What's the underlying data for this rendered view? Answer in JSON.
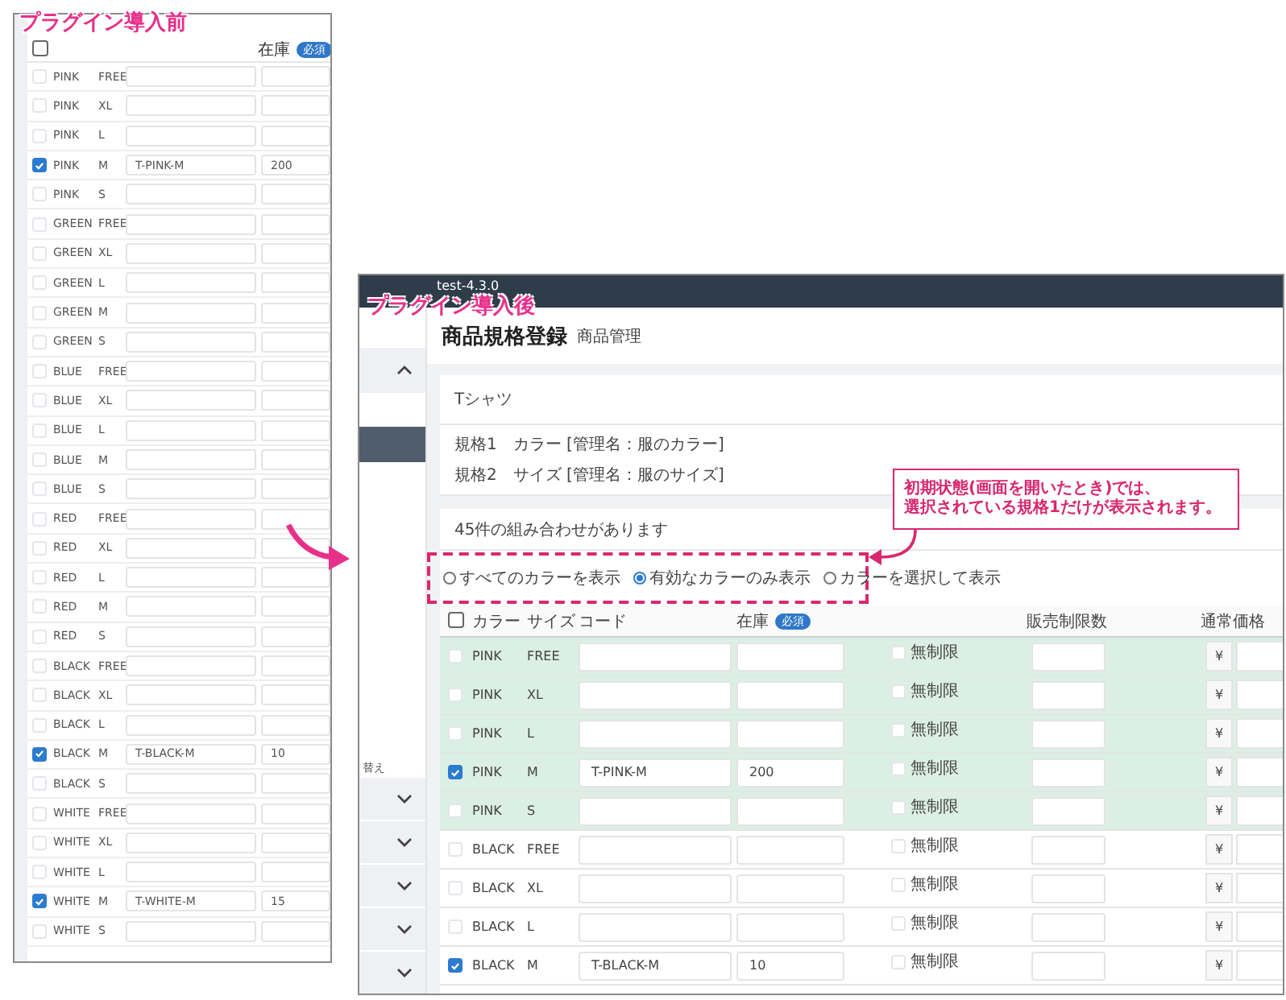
{
  "before": {
    "label": "プラグイン導入前",
    "header": {
      "all_selected": false,
      "stock": "在庫",
      "required": "必須"
    },
    "rows": [
      {
        "color_name": "PINK",
        "size": "FREE",
        "checked": false
      },
      {
        "color_name": "PINK",
        "size": "XL",
        "checked": false
      },
      {
        "color_name": "PINK",
        "size": "L",
        "checked": false
      },
      {
        "color_name": "PINK",
        "size": "M",
        "checked": true,
        "code": "T-PINK-M",
        "stock": "200"
      },
      {
        "color_name": "PINK",
        "size": "S",
        "checked": false
      },
      {
        "color_name": "GREEN",
        "size": "FREE",
        "checked": false
      },
      {
        "color_name": "GREEN",
        "size": "XL",
        "checked": false
      },
      {
        "color_name": "GREEN",
        "size": "L",
        "checked": false
      },
      {
        "color_name": "GREEN",
        "size": "M",
        "checked": false
      },
      {
        "color_name": "GREEN",
        "size": "S",
        "checked": false
      },
      {
        "color_name": "BLUE",
        "size": "FREE",
        "checked": false
      },
      {
        "color_name": "BLUE",
        "size": "XL",
        "checked": false
      },
      {
        "color_name": "BLUE",
        "size": "L",
        "checked": false
      },
      {
        "color_name": "BLUE",
        "size": "M",
        "checked": false
      },
      {
        "color_name": "BLUE",
        "size": "S",
        "checked": false
      },
      {
        "color_name": "RED",
        "size": "FREE",
        "checked": false
      },
      {
        "color_name": "RED",
        "size": "XL",
        "checked": false
      },
      {
        "color_name": "RED",
        "size": "L",
        "checked": false
      },
      {
        "color_name": "RED",
        "size": "M",
        "checked": false
      },
      {
        "color_name": "RED",
        "size": "S",
        "checked": false
      },
      {
        "color_name": "BLACK",
        "size": "FREE",
        "checked": false
      },
      {
        "color_name": "BLACK",
        "size": "XL",
        "checked": false
      },
      {
        "color_name": "BLACK",
        "size": "L",
        "checked": false
      },
      {
        "color_name": "BLACK",
        "size": "M",
        "checked": true,
        "code": "T-BLACK-M",
        "stock": "10"
      },
      {
        "color_name": "BLACK",
        "size": "S",
        "checked": false
      },
      {
        "color_name": "WHITE",
        "size": "FREE",
        "checked": false
      },
      {
        "color_name": "WHITE",
        "size": "XL",
        "checked": false
      },
      {
        "color_name": "WHITE",
        "size": "L",
        "checked": false
      },
      {
        "color_name": "WHITE",
        "size": "M",
        "checked": true,
        "code": "T-WHITE-M",
        "stock": "15"
      },
      {
        "color_name": "WHITE",
        "size": "S",
        "checked": false
      }
    ]
  },
  "after": {
    "label": "プラグイン導入後",
    "app_version": "test-4.3.0",
    "page_title": "商品規格登録",
    "breadcrumb": "商品管理",
    "sidebar_text": "替え",
    "product_name": "Tシャツ",
    "specs": [
      "規格1　カラー [管理名：服のカラー]",
      "規格2　サイズ [管理名：服のサイズ]"
    ],
    "combination_count": "45件の組み合わせがあります",
    "filter_options": [
      {
        "label": "すべてのカラーを表示",
        "selected": false
      },
      {
        "label": "有効なカラーのみ表示",
        "selected": true
      },
      {
        "label": "カラーを選択して表示",
        "selected": false
      }
    ],
    "callout": [
      "初期状態(画面を開いたとき)では、",
      "選択されている規格1だけが表示されます。"
    ],
    "columns": {
      "all_selected": false,
      "color_header": "カラー",
      "size": "サイズ",
      "code": "コード",
      "stock": "在庫",
      "required": "必須",
      "sale_limit": "販売制限数",
      "price": "通常価格"
    },
    "rows": [
      {
        "color_name": "PINK",
        "size": "FREE",
        "checked": false,
        "highlighted": true,
        "unlimited": "無制限",
        "unlimited_checked": false,
        "currency": "¥"
      },
      {
        "color_name": "PINK",
        "size": "XL",
        "checked": false,
        "highlighted": true,
        "unlimited": "無制限",
        "unlimited_checked": false,
        "currency": "¥"
      },
      {
        "color_name": "PINK",
        "size": "L",
        "checked": false,
        "highlighted": true,
        "unlimited": "無制限",
        "unlimited_checked": false,
        "currency": "¥"
      },
      {
        "color_name": "PINK",
        "size": "M",
        "checked": true,
        "highlighted": true,
        "code": "T-PINK-M",
        "stock": "200",
        "unlimited": "無制限",
        "unlimited_checked": false,
        "currency": "¥"
      },
      {
        "color_name": "PINK",
        "size": "S",
        "checked": false,
        "highlighted": true,
        "unlimited": "無制限",
        "unlimited_checked": false,
        "currency": "¥"
      },
      {
        "color_name": "BLACK",
        "size": "FREE",
        "checked": false,
        "highlighted": false,
        "unlimited": "無制限",
        "unlimited_checked": false,
        "currency": "¥"
      },
      {
        "color_name": "BLACK",
        "size": "XL",
        "checked": false,
        "highlighted": false,
        "unlimited": "無制限",
        "unlimited_checked": false,
        "currency": "¥"
      },
      {
        "color_name": "BLACK",
        "size": "L",
        "checked": false,
        "highlighted": false,
        "unlimited": "無制限",
        "unlimited_checked": false,
        "currency": "¥"
      },
      {
        "color_name": "BLACK",
        "size": "M",
        "checked": true,
        "highlighted": false,
        "code": "T-BLACK-M",
        "stock": "10",
        "unlimited": "無制限",
        "unlimited_checked": false,
        "currency": "¥"
      }
    ]
  }
}
